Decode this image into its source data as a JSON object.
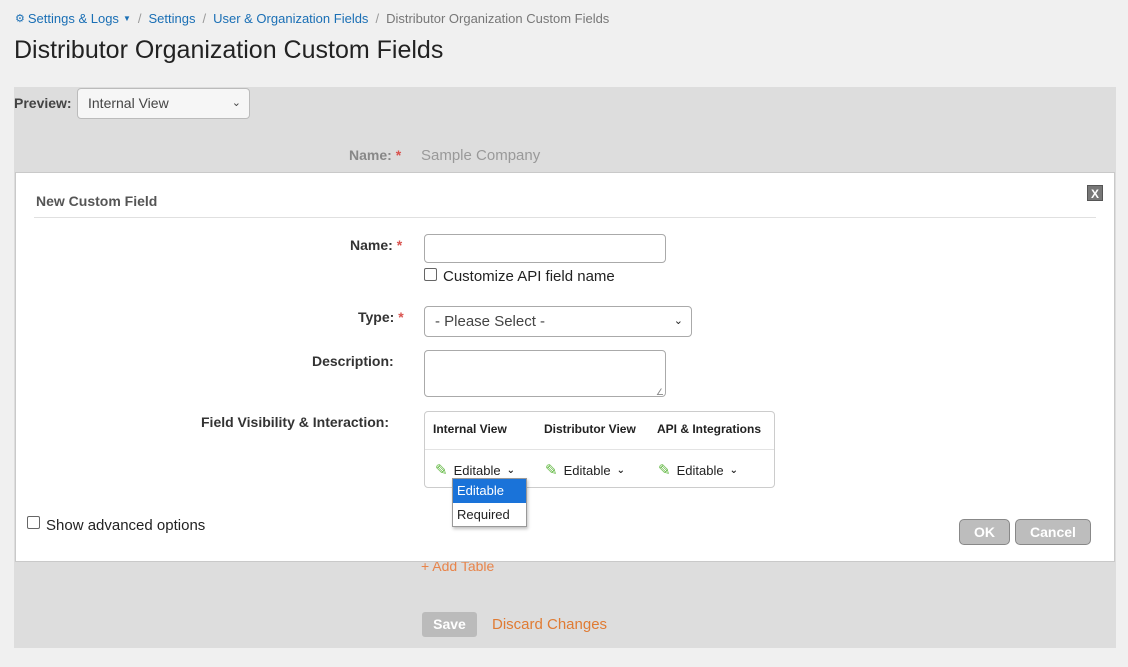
{
  "breadcrumb": {
    "settings_logs": "Settings & Logs",
    "settings": "Settings",
    "user_org_fields": "User & Organization Fields",
    "current": "Distributor Organization Custom Fields"
  },
  "page": {
    "title": "Distributor Organization Custom Fields"
  },
  "preview": {
    "label": "Preview:",
    "selected": "Internal View"
  },
  "background_form": {
    "name_label": "Name:",
    "name_value": "Sample Company",
    "add_table": "+ Add Table",
    "save": "Save",
    "discard": "Discard Changes"
  },
  "dialog": {
    "title": "New Custom Field",
    "close": "X",
    "name_label": "Name:",
    "name_value": "",
    "customize_api": "Customize API field name",
    "type_label": "Type:",
    "type_selected": "- Please Select -",
    "description_label": "Description:",
    "description_value": "",
    "visibility_label": "Field Visibility & Interaction:",
    "visibility": {
      "headers": [
        "Internal View",
        "Distributor View",
        "API & Integrations"
      ],
      "values": [
        "Editable",
        "Editable",
        "Editable"
      ]
    },
    "dropdown_options": [
      "Editable",
      "Required"
    ],
    "show_advanced": "Show advanced options",
    "ok": "OK",
    "cancel": "Cancel",
    "required_mark": "*"
  },
  "colors": {
    "link": "#1a6fb5",
    "accent_orange": "#e07b33",
    "required": "#d9534f",
    "pencil": "#5bb53a",
    "dropdown_highlight": "#1a73d9"
  }
}
